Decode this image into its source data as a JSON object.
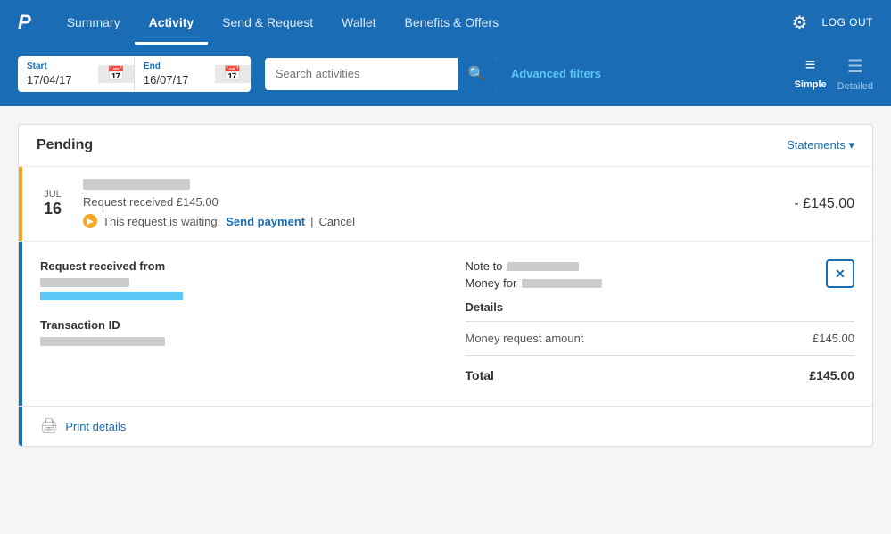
{
  "brand": {
    "logo": "P",
    "logo_style": "italic"
  },
  "navbar": {
    "links": [
      {
        "id": "summary",
        "label": "Summary",
        "active": false
      },
      {
        "id": "activity",
        "label": "Activity",
        "active": true
      },
      {
        "id": "send-request",
        "label": "Send & Request",
        "active": false
      },
      {
        "id": "wallet",
        "label": "Wallet",
        "active": false
      },
      {
        "id": "benefits",
        "label": "Benefits & Offers",
        "active": false
      }
    ],
    "settings_label": "⚙",
    "logout_label": "LOG OUT"
  },
  "filters": {
    "start_label": "Start",
    "start_date": "17/04/17",
    "end_label": "End",
    "end_date": "16/07/17",
    "search_placeholder": "Search activities",
    "advanced_filters_label": "Advanced filters",
    "view_simple_label": "Simple",
    "view_detailed_label": "Detailed"
  },
  "activity": {
    "pending_label": "Pending",
    "statements_label": "Statements ▾",
    "transaction": {
      "month": "JUL",
      "day": "16",
      "description": "Request received £145.00",
      "status_text": "This request is waiting.",
      "send_payment_label": "Send payment",
      "cancel_label": "Cancel",
      "amount": "- £145.00"
    },
    "detail": {
      "request_from_label": "Request received from",
      "transaction_id_label": "Transaction ID",
      "note_to_label": "Note to",
      "money_for_label": "Money for",
      "details_label": "Details",
      "detail_row_label": "Money request amount",
      "detail_row_value": "£145.00",
      "total_label": "Total",
      "total_value": "£145.00"
    },
    "print_label": "Print details"
  }
}
